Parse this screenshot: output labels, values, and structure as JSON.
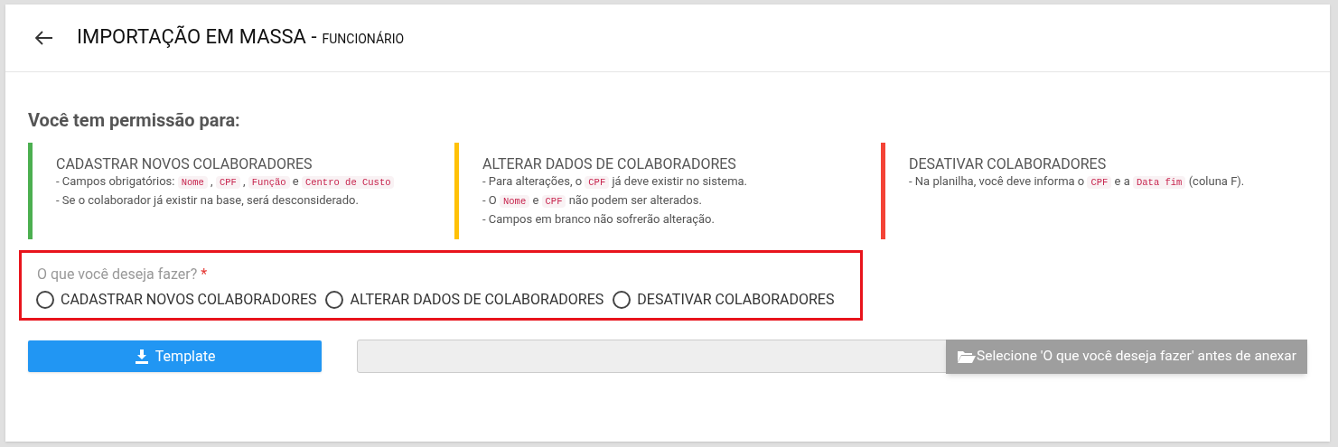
{
  "header": {
    "title": "IMPORTAÇÃO EM MASSA -",
    "subtitle": "FUNCIONÁRIO"
  },
  "permissions": {
    "heading": "Você tem permissão para:",
    "blocks": [
      {
        "title": "CADASTRAR NOVOS COLABORADORES",
        "color": "#4caf50",
        "lines": [
          [
            {
              "kind": "text",
              "text": "- Campos obrigatórios: "
            },
            {
              "kind": "code",
              "text": "Nome"
            },
            {
              "kind": "text",
              "text": " , "
            },
            {
              "kind": "code",
              "text": "CPF"
            },
            {
              "kind": "text",
              "text": " , "
            },
            {
              "kind": "code",
              "text": "Função"
            },
            {
              "kind": "text",
              "text": " e "
            },
            {
              "kind": "code",
              "text": "Centro de Custo"
            }
          ],
          [
            {
              "kind": "text",
              "text": "- Se o colaborador já existir na base, será desconsiderado."
            }
          ]
        ]
      },
      {
        "title": "ALTERAR DADOS DE COLABORADORES",
        "color": "#ffc107",
        "lines": [
          [
            {
              "kind": "text",
              "text": "- Para alterações, o "
            },
            {
              "kind": "code",
              "text": "CPF"
            },
            {
              "kind": "text",
              "text": " já deve existir no sistema."
            }
          ],
          [
            {
              "kind": "text",
              "text": "- O "
            },
            {
              "kind": "code",
              "text": "Nome"
            },
            {
              "kind": "text",
              "text": " e "
            },
            {
              "kind": "code",
              "text": "CPF"
            },
            {
              "kind": "text",
              "text": " não podem ser alterados."
            }
          ],
          [
            {
              "kind": "text",
              "text": "- Campos em branco não sofrerão alteração."
            }
          ]
        ]
      },
      {
        "title": "DESATIVAR COLABORADORES",
        "color": "#f44336",
        "lines": [
          [
            {
              "kind": "text",
              "text": "- Na planilha, você deve informa o "
            },
            {
              "kind": "code",
              "text": "CPF"
            },
            {
              "kind": "text",
              "text": " e a "
            },
            {
              "kind": "code",
              "text": "Data fim"
            },
            {
              "kind": "text",
              "text": " (coluna F)."
            }
          ]
        ]
      }
    ]
  },
  "question": {
    "label": "O que você deseja fazer?",
    "required_mark": "*",
    "options": [
      {
        "label": "CADASTRAR NOVOS COLABORADORES",
        "selected": false
      },
      {
        "label": "ALTERAR DADOS DE COLABORADORES",
        "selected": false
      },
      {
        "label": "DESATIVAR COLABORADORES",
        "selected": false
      }
    ]
  },
  "template_button": "Template",
  "upload": {
    "button": "Selecione 'O que você deseja fazer' antes de anexar",
    "disabled": true
  }
}
